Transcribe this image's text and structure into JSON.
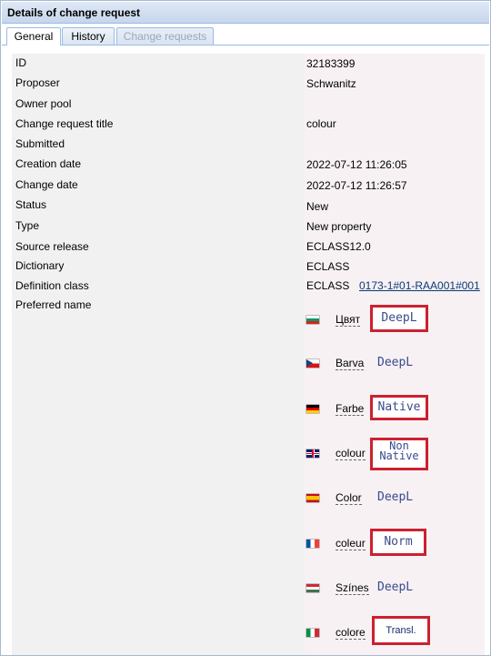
{
  "panel": {
    "title": "Details of change request"
  },
  "tabs": [
    {
      "label": "General",
      "state": "active"
    },
    {
      "label": "History",
      "state": "inactive"
    },
    {
      "label": "Change requests",
      "state": "disabled"
    }
  ],
  "fields": [
    {
      "label": "ID",
      "value": "32183399"
    },
    {
      "label": "Proposer",
      "value": "Schwanitz"
    },
    {
      "label": "Owner pool",
      "value": ""
    },
    {
      "label": "Change request title",
      "value": "colour"
    },
    {
      "label": "Submitted",
      "value": ""
    },
    {
      "label": "Creation date",
      "value": "2022-07-12 11:26:05"
    },
    {
      "label": "Change date",
      "value": "2022-07-12 11:26:57"
    },
    {
      "label": "Status",
      "value": "New"
    },
    {
      "label": "Type",
      "value": "New property"
    },
    {
      "label": "Source release",
      "value": "ECLASS12.0"
    },
    {
      "label": "Dictionary",
      "value": "ECLASS"
    },
    {
      "label": "Definition class",
      "value": "ECLASS",
      "link": "0173-1#01-RAA001#001"
    },
    {
      "label": "Preferred name",
      "value": ""
    }
  ],
  "preferred_names": [
    {
      "flag": "bulgaria-flag-icon",
      "name": "Цвят",
      "tag": "DeepL",
      "highlighted": true
    },
    {
      "flag": "czech-flag-icon",
      "name": "Barva",
      "tag": "DeepL",
      "highlighted": false
    },
    {
      "flag": "germany-flag-icon",
      "name": "Farbe",
      "tag": "Native",
      "highlighted": true
    },
    {
      "flag": "uk-flag-icon",
      "name": "colour",
      "tag_line1": "Non",
      "tag_line2": "Native",
      "highlighted": true
    },
    {
      "flag": "spain-flag-icon",
      "name": "Color",
      "tag": "DeepL",
      "highlighted": false
    },
    {
      "flag": "france-flag-icon",
      "name": "coleur",
      "tag": "Norm",
      "highlighted": true
    },
    {
      "flag": "hungary-flag-icon",
      "name": "Színes",
      "tag": "DeepL",
      "highlighted": false
    },
    {
      "flag": "italy-flag-icon",
      "name": "colore",
      "tag": "Transl.",
      "highlighted": true
    }
  ],
  "colors": {
    "highlight_border": "#cc2130",
    "tag_text": "#3a4a8c",
    "panel_border": "#99bbe8"
  }
}
